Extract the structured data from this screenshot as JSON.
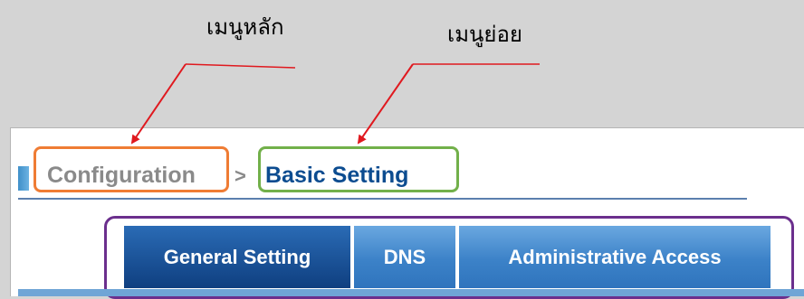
{
  "annotations": {
    "main_menu_label": "เมนูหลัก",
    "sub_menu_label": "เมนูย่อย"
  },
  "breadcrumb": {
    "main": "Configuration",
    "separator": ">",
    "sub": "Basic Setting"
  },
  "tabs": [
    {
      "label": "General Setting",
      "active": true
    },
    {
      "label": "DNS",
      "active": false
    },
    {
      "label": "Administrative Access",
      "active": false
    }
  ],
  "colors": {
    "main_highlight": "#ef7c34",
    "sub_highlight": "#72b04a",
    "tabs_highlight": "#6b2f8d",
    "arrow": "#e0191f",
    "breadcrumb_sub_text": "#0c4c90"
  }
}
